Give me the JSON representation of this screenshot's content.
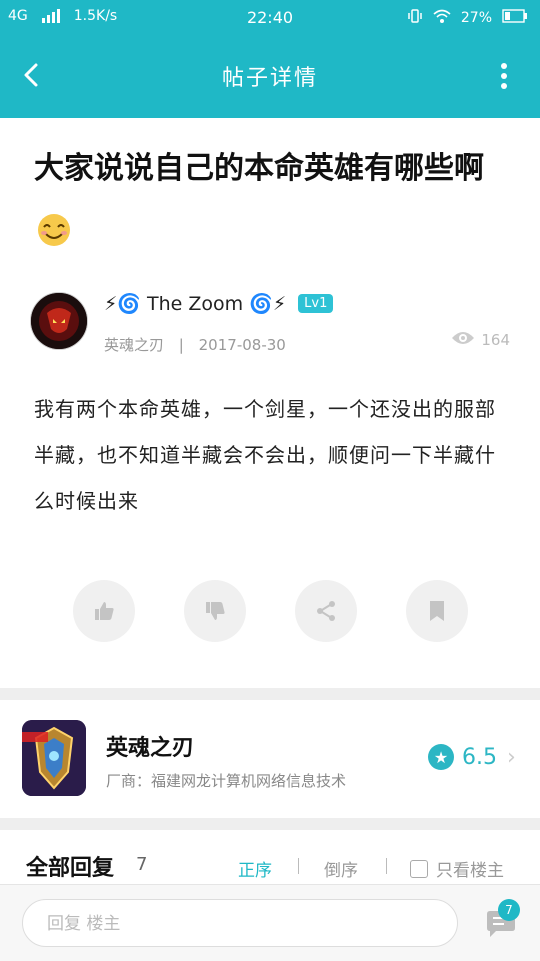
{
  "status_bar": {
    "network": "4G",
    "speed": "1.5K/s",
    "time": "22:40",
    "battery": "27%"
  },
  "nav": {
    "title": "帖子详情"
  },
  "post": {
    "title": "大家说说自己的本命英雄有哪些啊",
    "author": {
      "name": "The Zoom",
      "level": "Lv1",
      "prefix_emoji": "⚡🌀",
      "suffix_emoji": "🌀⚡"
    },
    "game_tag": "英魂之刃",
    "date": "2017-08-30",
    "views": "164",
    "body": "我有两个本命英雄，一个剑星，一个还没出的服部半藏，也不知道半藏会不会出，顺便问一下半藏什么时候出来"
  },
  "game_card": {
    "name": "英魂之刃",
    "vendor": "厂商：福建网龙计算机网络信息技术",
    "rating": "6.5"
  },
  "replies": {
    "title": "全部回复",
    "count": "7",
    "sort_asc": "正序",
    "sort_desc": "倒序",
    "only_op": "只看楼主"
  },
  "reply_bar": {
    "placeholder": "回复 楼主",
    "badge": "7"
  },
  "colors": {
    "accent": "#1fb8c6",
    "divider": "#eeeeee"
  },
  "icons": [
    "back-icon",
    "more-icon",
    "like-icon",
    "dislike-icon",
    "share-icon",
    "bookmark-icon",
    "eye-icon",
    "star-icon",
    "chevron-right-icon",
    "comment-icon"
  ]
}
